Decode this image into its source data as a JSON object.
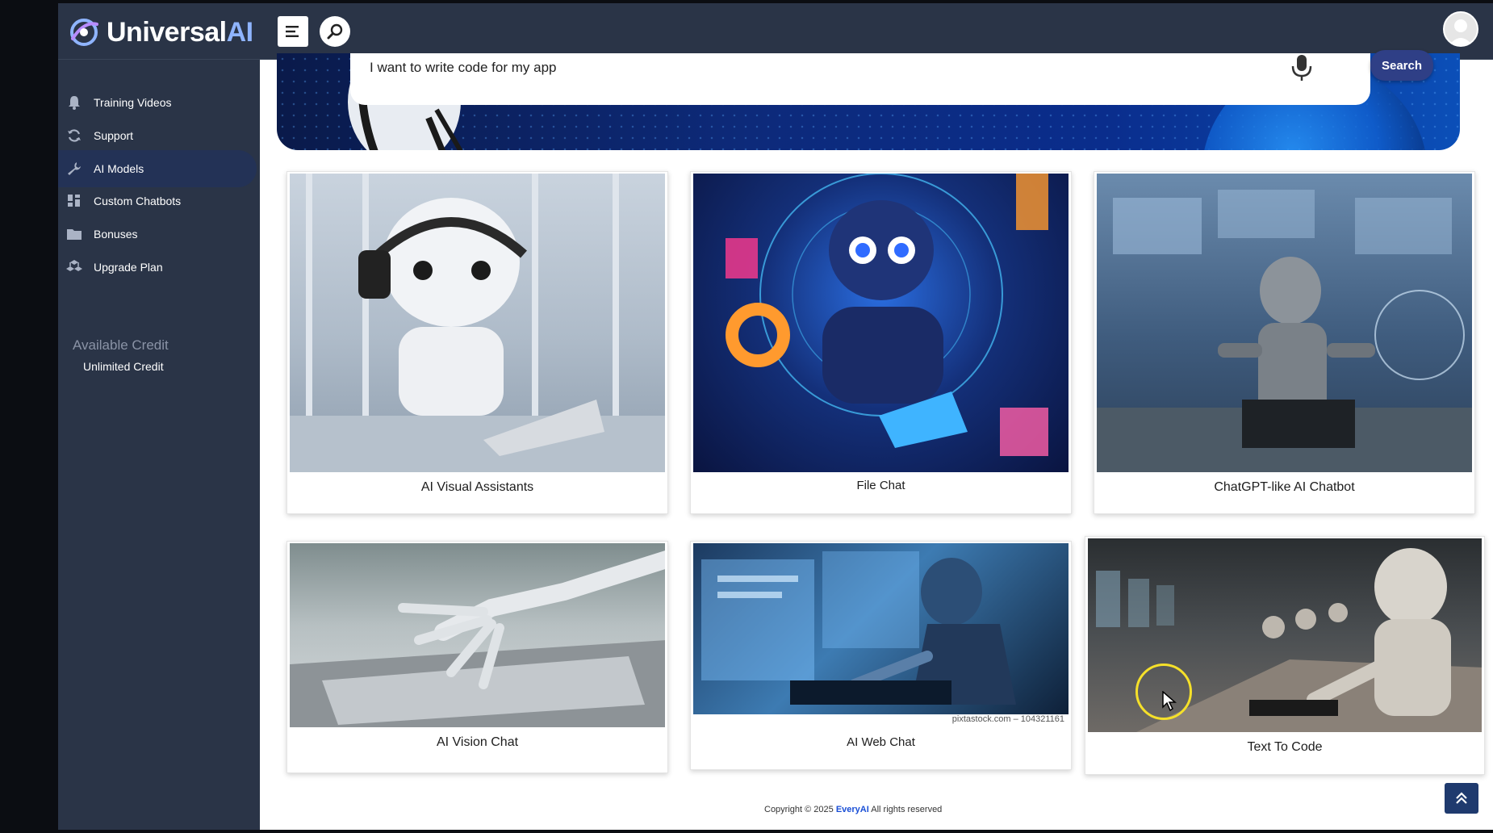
{
  "app": {
    "logo_main": "Universal",
    "logo_accent": "AI"
  },
  "sidebar": {
    "items": [
      {
        "label": "Training Videos",
        "icon": "bell-icon"
      },
      {
        "label": "Support",
        "icon": "refresh-icon"
      },
      {
        "label": "AI Models",
        "icon": "wrench-icon",
        "active": true
      },
      {
        "label": "Custom Chatbots",
        "icon": "dashboard-icon"
      },
      {
        "label": "Bonuses",
        "icon": "folder-icon"
      },
      {
        "label": "Upgrade Plan",
        "icon": "boxes-icon"
      }
    ],
    "credit_title": "Available Credit",
    "credit_value": "Unlimited Credit"
  },
  "search": {
    "query": "I want to write code for my app",
    "button_label": "Search"
  },
  "cards": [
    {
      "label": "AI Visual Assistants"
    },
    {
      "label": "File Chat"
    },
    {
      "label": "ChatGPT-like AI Chatbot"
    },
    {
      "label": "AI Vision Chat"
    },
    {
      "label": "AI Web Chat",
      "credit_line": "pixtastock.com – 104321161"
    },
    {
      "label": "Text To Code"
    }
  ],
  "footer": {
    "prefix": "Copyright © 2025",
    "brand": "EveryAI",
    "suffix": "All rights reserved"
  },
  "colors": {
    "sidebar_bg": "#2a3447",
    "active_item_bg": "#233256",
    "search_button": "#2f3f86"
  }
}
